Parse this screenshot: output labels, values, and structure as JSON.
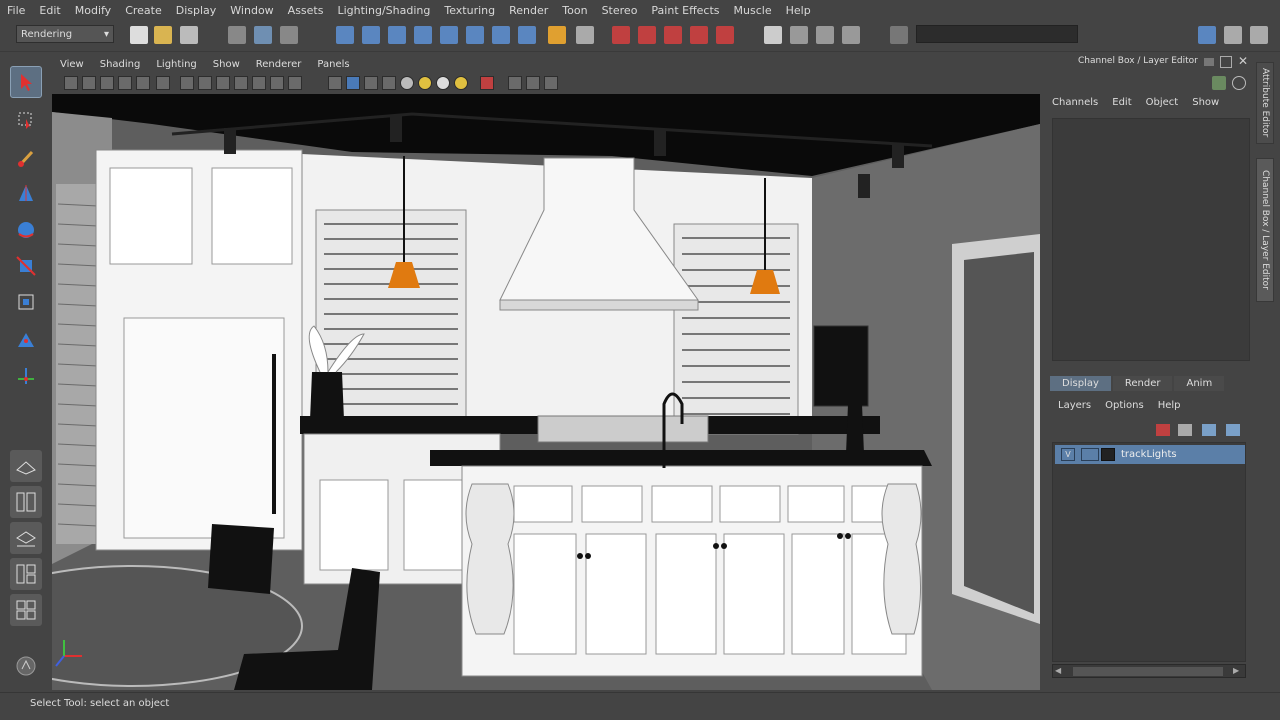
{
  "menubar": {
    "items": [
      "File",
      "Edit",
      "Modify",
      "Create",
      "Display",
      "Window",
      "Assets",
      "Lighting/Shading",
      "Texturing",
      "Render",
      "Toon",
      "Stereo",
      "Paint Effects",
      "Muscle",
      "Help"
    ]
  },
  "statusline": {
    "mode": "Rendering"
  },
  "panel": {
    "menu": [
      "View",
      "Shading",
      "Lighting",
      "Show",
      "Renderer",
      "Panels"
    ]
  },
  "channel_box": {
    "title": "Channel Box / Layer Editor",
    "menu": [
      "Channels",
      "Edit",
      "Object",
      "Show"
    ]
  },
  "layer_editor": {
    "tabs": [
      "Display",
      "Render",
      "Anim"
    ],
    "active_tab": "Display",
    "menu": [
      "Layers",
      "Options",
      "Help"
    ],
    "layers": [
      {
        "visible": "V",
        "name": "trackLights"
      }
    ]
  },
  "side_tabs": [
    "Attribute Editor",
    "Channel Box / Layer Editor"
  ],
  "helpline": {
    "text": "Select Tool: select an object"
  },
  "colors": {
    "ui_bg": "#444444",
    "selection": "#5b7fa8",
    "pendant": "#e07a10"
  }
}
